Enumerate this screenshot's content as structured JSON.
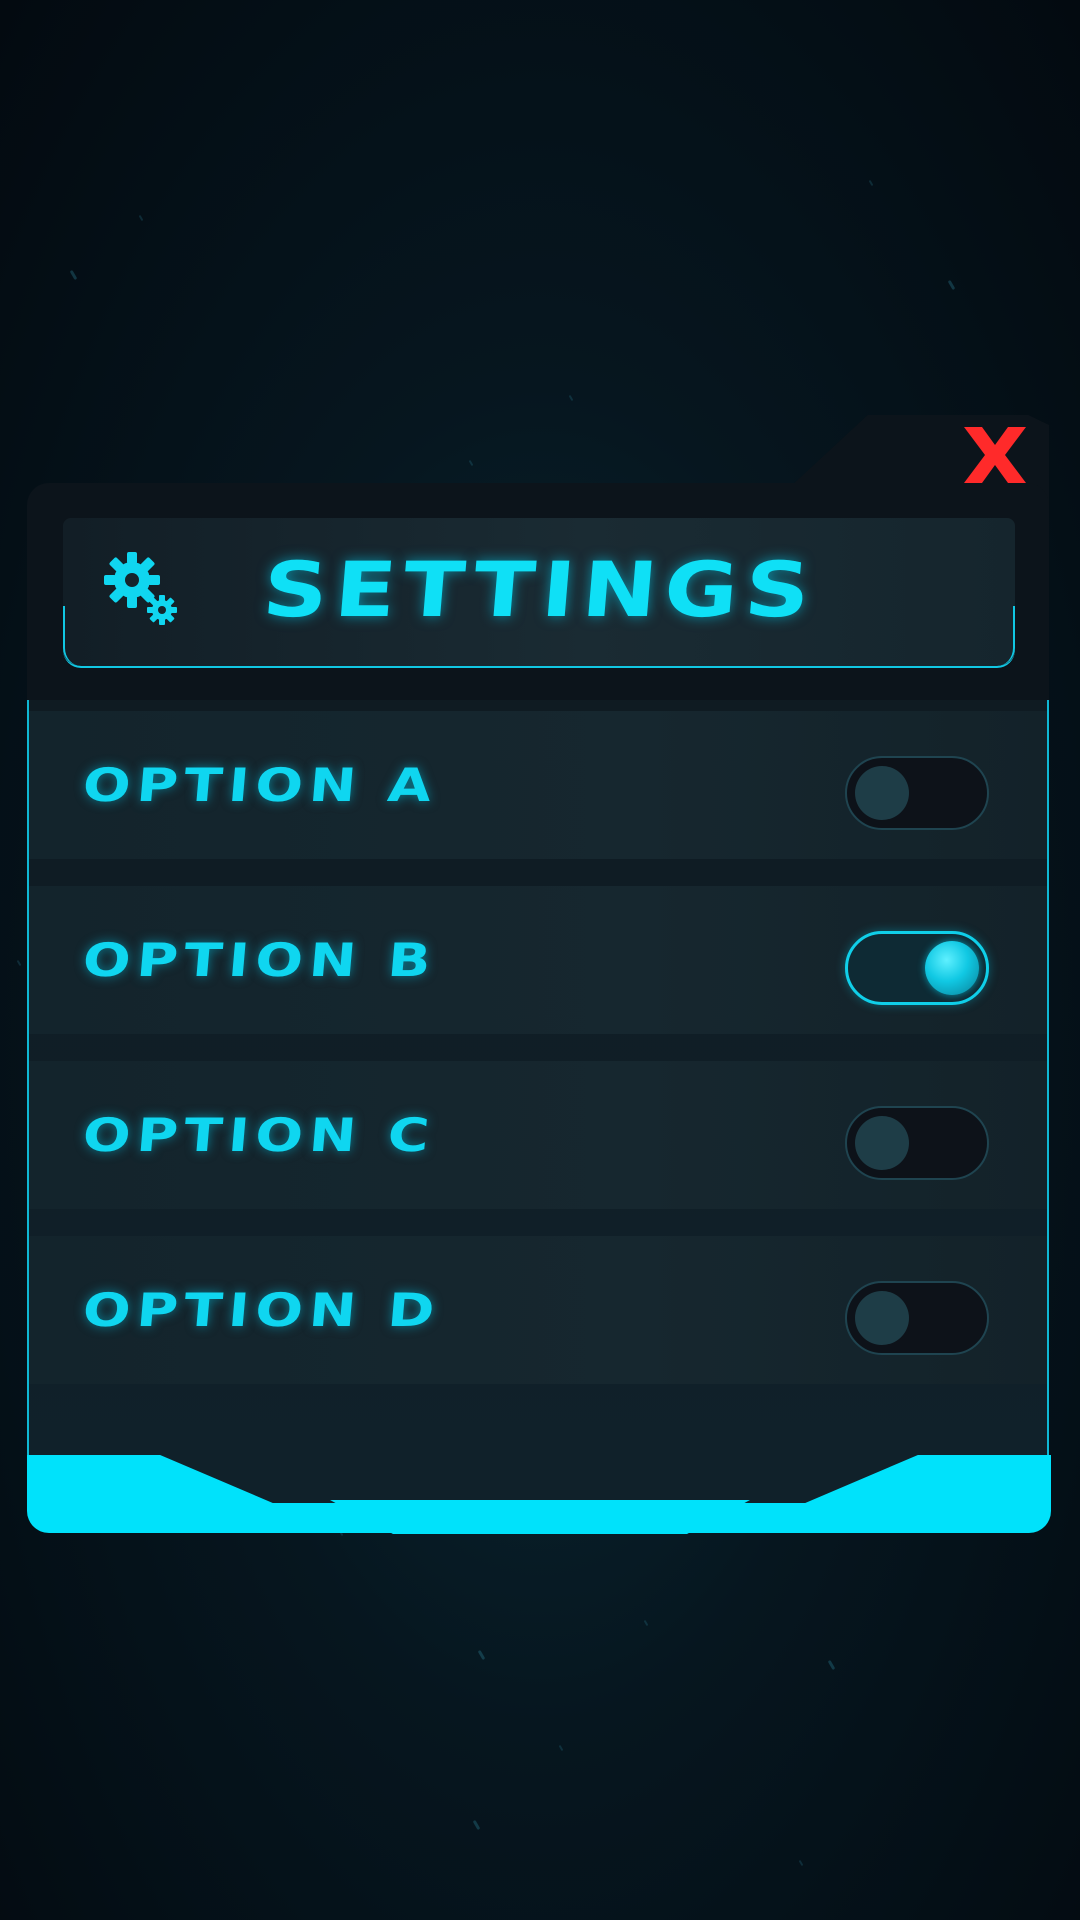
{
  "header": {
    "title": "SETTINGS",
    "icon": "gear-icon"
  },
  "close": {
    "label": "X",
    "icon": "close-icon",
    "color": "#ff2a2a"
  },
  "options": [
    {
      "label": "OPTION A",
      "enabled": false
    },
    {
      "label": "OPTION B",
      "enabled": true
    },
    {
      "label": "OPTION C",
      "enabled": false
    },
    {
      "label": "OPTION D",
      "enabled": false
    }
  ],
  "colors": {
    "accent": "#00e2fb",
    "panel": "#0c141b",
    "toggle_off_knob": "#1e3d47"
  }
}
